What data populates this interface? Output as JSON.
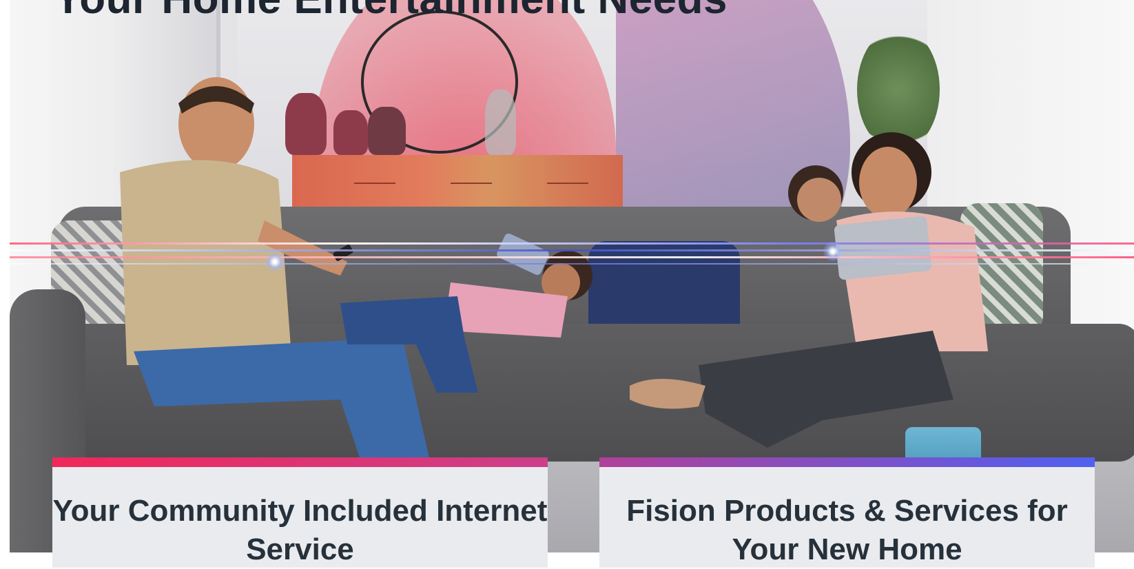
{
  "headline": "Your Home Entertainment Needs",
  "cards": [
    {
      "title": "Your Community Included Internet Service",
      "bar_from": "#f0285a",
      "bar_to": "#cc3f8a"
    },
    {
      "title": "Fision Products & Services for Your New Home",
      "bar_from": "#b0409a",
      "bar_to": "#5060f0"
    }
  ],
  "colors": {
    "headline_text": "#1c2530",
    "card_text": "#26313b",
    "card_bg": "#e9ebee"
  }
}
